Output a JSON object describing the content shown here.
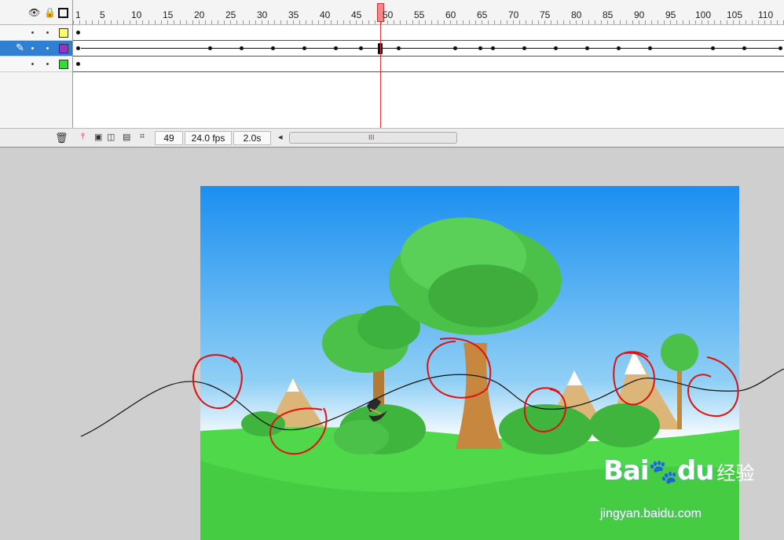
{
  "timeline": {
    "header_icons": [
      "eye-icon",
      "lock-icon",
      "outline-icon"
    ],
    "ruler_labels": [
      "1",
      "5",
      "10",
      "15",
      "20",
      "25",
      "30",
      "35",
      "40",
      "45",
      "50",
      "55",
      "60",
      "65",
      "70",
      "75",
      "80",
      "85",
      "90",
      "95",
      "100",
      "105",
      "110"
    ],
    "layers": [
      {
        "color": "#ffff66",
        "active": false,
        "icon": ""
      },
      {
        "color": "#9933cc",
        "active": true,
        "icon": "pencil-icon"
      },
      {
        "color": "#33dd33",
        "active": false,
        "icon": ""
      }
    ],
    "current_frame": 50
  },
  "status_bar": {
    "frame": "49",
    "fps": "24.0 fps",
    "time": "2.0s",
    "scroll_grip": "III"
  },
  "stage": {
    "sky_top": "#1a8ff0",
    "sky_bottom": "#ffffff",
    "grass": "#4ed84a"
  },
  "watermark": {
    "logo": "Bai",
    "logo2": "du",
    "cn": "经验",
    "url": "jingyan.baidu.com"
  }
}
